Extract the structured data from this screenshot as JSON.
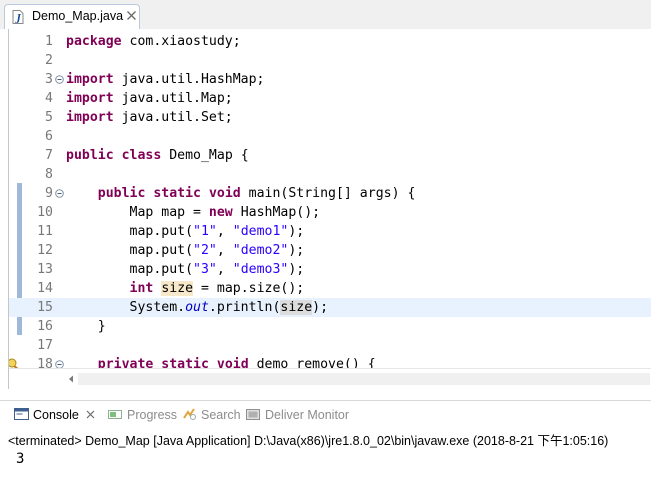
{
  "editor": {
    "tab_title": "Demo_Map.java",
    "lines": [
      {
        "num": "1",
        "tokens": [
          {
            "t": "package",
            "k": "kw"
          },
          {
            "t": " com.xiaostudy;"
          }
        ]
      },
      {
        "num": "2",
        "tokens": []
      },
      {
        "num": "3",
        "fold": true,
        "tokens": [
          {
            "t": "import",
            "k": "kw"
          },
          {
            "t": " java.util.HashMap;"
          }
        ]
      },
      {
        "num": "4",
        "tokens": [
          {
            "t": "import",
            "k": "kw"
          },
          {
            "t": " java.util.Map;"
          }
        ]
      },
      {
        "num": "5",
        "tokens": [
          {
            "t": "import",
            "k": "kw"
          },
          {
            "t": " java.util.Set;"
          }
        ]
      },
      {
        "num": "6",
        "tokens": []
      },
      {
        "num": "7",
        "tokens": [
          {
            "t": "public",
            "k": "kw"
          },
          {
            "t": " "
          },
          {
            "t": "class",
            "k": "kw"
          },
          {
            "t": " Demo_Map {"
          }
        ]
      },
      {
        "num": "8",
        "tokens": []
      },
      {
        "num": "9",
        "fold": true,
        "tokens": [
          {
            "t": "    "
          },
          {
            "t": "public",
            "k": "kw"
          },
          {
            "t": " "
          },
          {
            "t": "static",
            "k": "kw"
          },
          {
            "t": " "
          },
          {
            "t": "void",
            "k": "kw"
          },
          {
            "t": " main(String[] args) {"
          }
        ]
      },
      {
        "num": "10",
        "tokens": [
          {
            "t": "        Map map = "
          },
          {
            "t": "new",
            "k": "kw"
          },
          {
            "t": " HashMap();"
          }
        ]
      },
      {
        "num": "11",
        "tokens": [
          {
            "t": "        map.put("
          },
          {
            "t": "\"1\"",
            "k": "str"
          },
          {
            "t": ", "
          },
          {
            "t": "\"demo1\"",
            "k": "str"
          },
          {
            "t": ");"
          }
        ]
      },
      {
        "num": "12",
        "tokens": [
          {
            "t": "        map.put("
          },
          {
            "t": "\"2\"",
            "k": "str"
          },
          {
            "t": ", "
          },
          {
            "t": "\"demo2\"",
            "k": "str"
          },
          {
            "t": ");"
          }
        ]
      },
      {
        "num": "13",
        "tokens": [
          {
            "t": "        map.put("
          },
          {
            "t": "\"3\"",
            "k": "str"
          },
          {
            "t": ", "
          },
          {
            "t": "\"demo3\"",
            "k": "str"
          },
          {
            "t": ");"
          }
        ]
      },
      {
        "num": "14",
        "tokens": [
          {
            "t": "        "
          },
          {
            "t": "int",
            "k": "kw"
          },
          {
            "t": " "
          },
          {
            "t": "size",
            "k": "hl"
          },
          {
            "t": " = map.size();"
          }
        ]
      },
      {
        "num": "15",
        "current": true,
        "tokens": [
          {
            "t": "        System."
          },
          {
            "t": "out",
            "k": "field"
          },
          {
            "t": ".println("
          },
          {
            "t": "size",
            "k": "hl2"
          },
          {
            "t": ");"
          }
        ]
      },
      {
        "num": "16",
        "tokens": [
          {
            "t": "    }"
          }
        ]
      },
      {
        "num": "17",
        "tokens": []
      },
      {
        "num": "18",
        "fold": true,
        "warning": true,
        "tokens": [
          {
            "t": "    "
          },
          {
            "t": "private",
            "k": "kw"
          },
          {
            "t": " "
          },
          {
            "t": "static",
            "k": "kw"
          },
          {
            "t": " "
          },
          {
            "t": "void",
            "k": "kw"
          },
          {
            "t": " demo_remove() {"
          }
        ]
      }
    ]
  },
  "console": {
    "tabs": [
      {
        "label": "Console",
        "icon": "console-icon",
        "active": true
      },
      {
        "label": "Progress",
        "icon": "progress-icon",
        "active": false
      },
      {
        "label": "Search",
        "icon": "search-icon",
        "active": false
      },
      {
        "label": "Deliver Monitor",
        "icon": "deliver-monitor-icon",
        "active": false
      }
    ],
    "status": "<terminated> Demo_Map [Java Application] D:\\Java(x86)\\jre1.8.0_02\\bin\\javaw.exe (2018-8-21 下午1:05:16)",
    "output": "3"
  },
  "colors": {
    "keyword": "#7f0055",
    "string": "#2a00ff",
    "field": "#0000c0",
    "current_line": "#e8f2fe",
    "occurrence_highlight": "#f7e8ca"
  }
}
